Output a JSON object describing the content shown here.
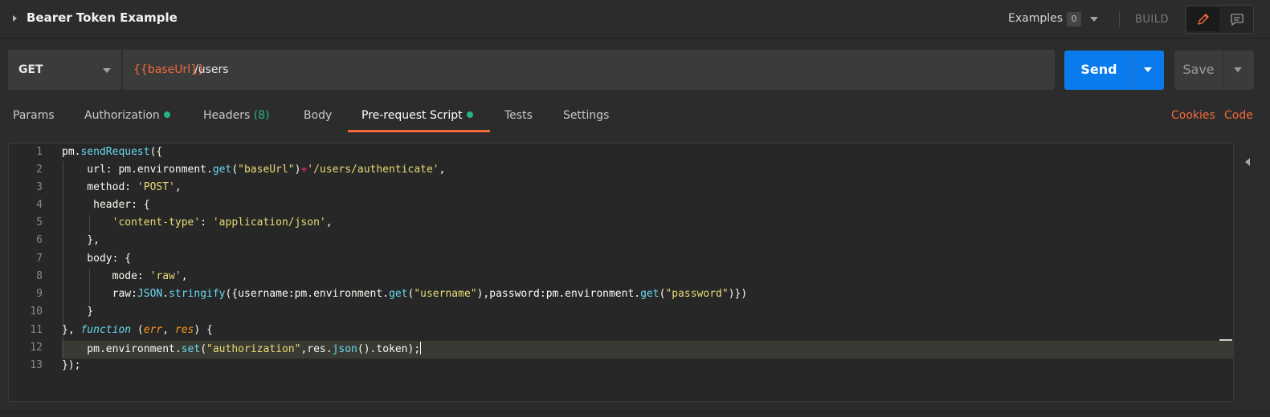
{
  "title": {
    "text": "Bearer Token Example"
  },
  "examples": {
    "label": "Examples",
    "count": "0"
  },
  "build_label": "BUILD",
  "request": {
    "method": "GET",
    "url_variable": "{{baseUrl}}",
    "url_path": "/users"
  },
  "buttons": {
    "send": "Send",
    "save": "Save"
  },
  "tabs": [
    {
      "label": "Params"
    },
    {
      "label": "Authorization",
      "dot": true
    },
    {
      "label": "Headers",
      "count": "(8)"
    },
    {
      "label": "Body"
    },
    {
      "label": "Pre-request Script",
      "dot": true,
      "active": true
    },
    {
      "label": "Tests"
    },
    {
      "label": "Settings"
    }
  ],
  "links": {
    "cookies": "Cookies",
    "code": "Code"
  },
  "editor": {
    "line_numbers": [
      "1",
      "2",
      "3",
      "4",
      "5",
      "6",
      "7",
      "8",
      "9",
      "10",
      "11",
      "12",
      "13"
    ],
    "active_line": 12
  },
  "colors": {
    "accent": "#f26b3a",
    "send_blue": "#097bed",
    "status_green": "#26b47f",
    "editor_bg": "#272727"
  },
  "icons": [
    "expand-caret-icon",
    "chevron-down-icon",
    "pencil-icon",
    "comment-icon",
    "collapse-panel-icon"
  ]
}
